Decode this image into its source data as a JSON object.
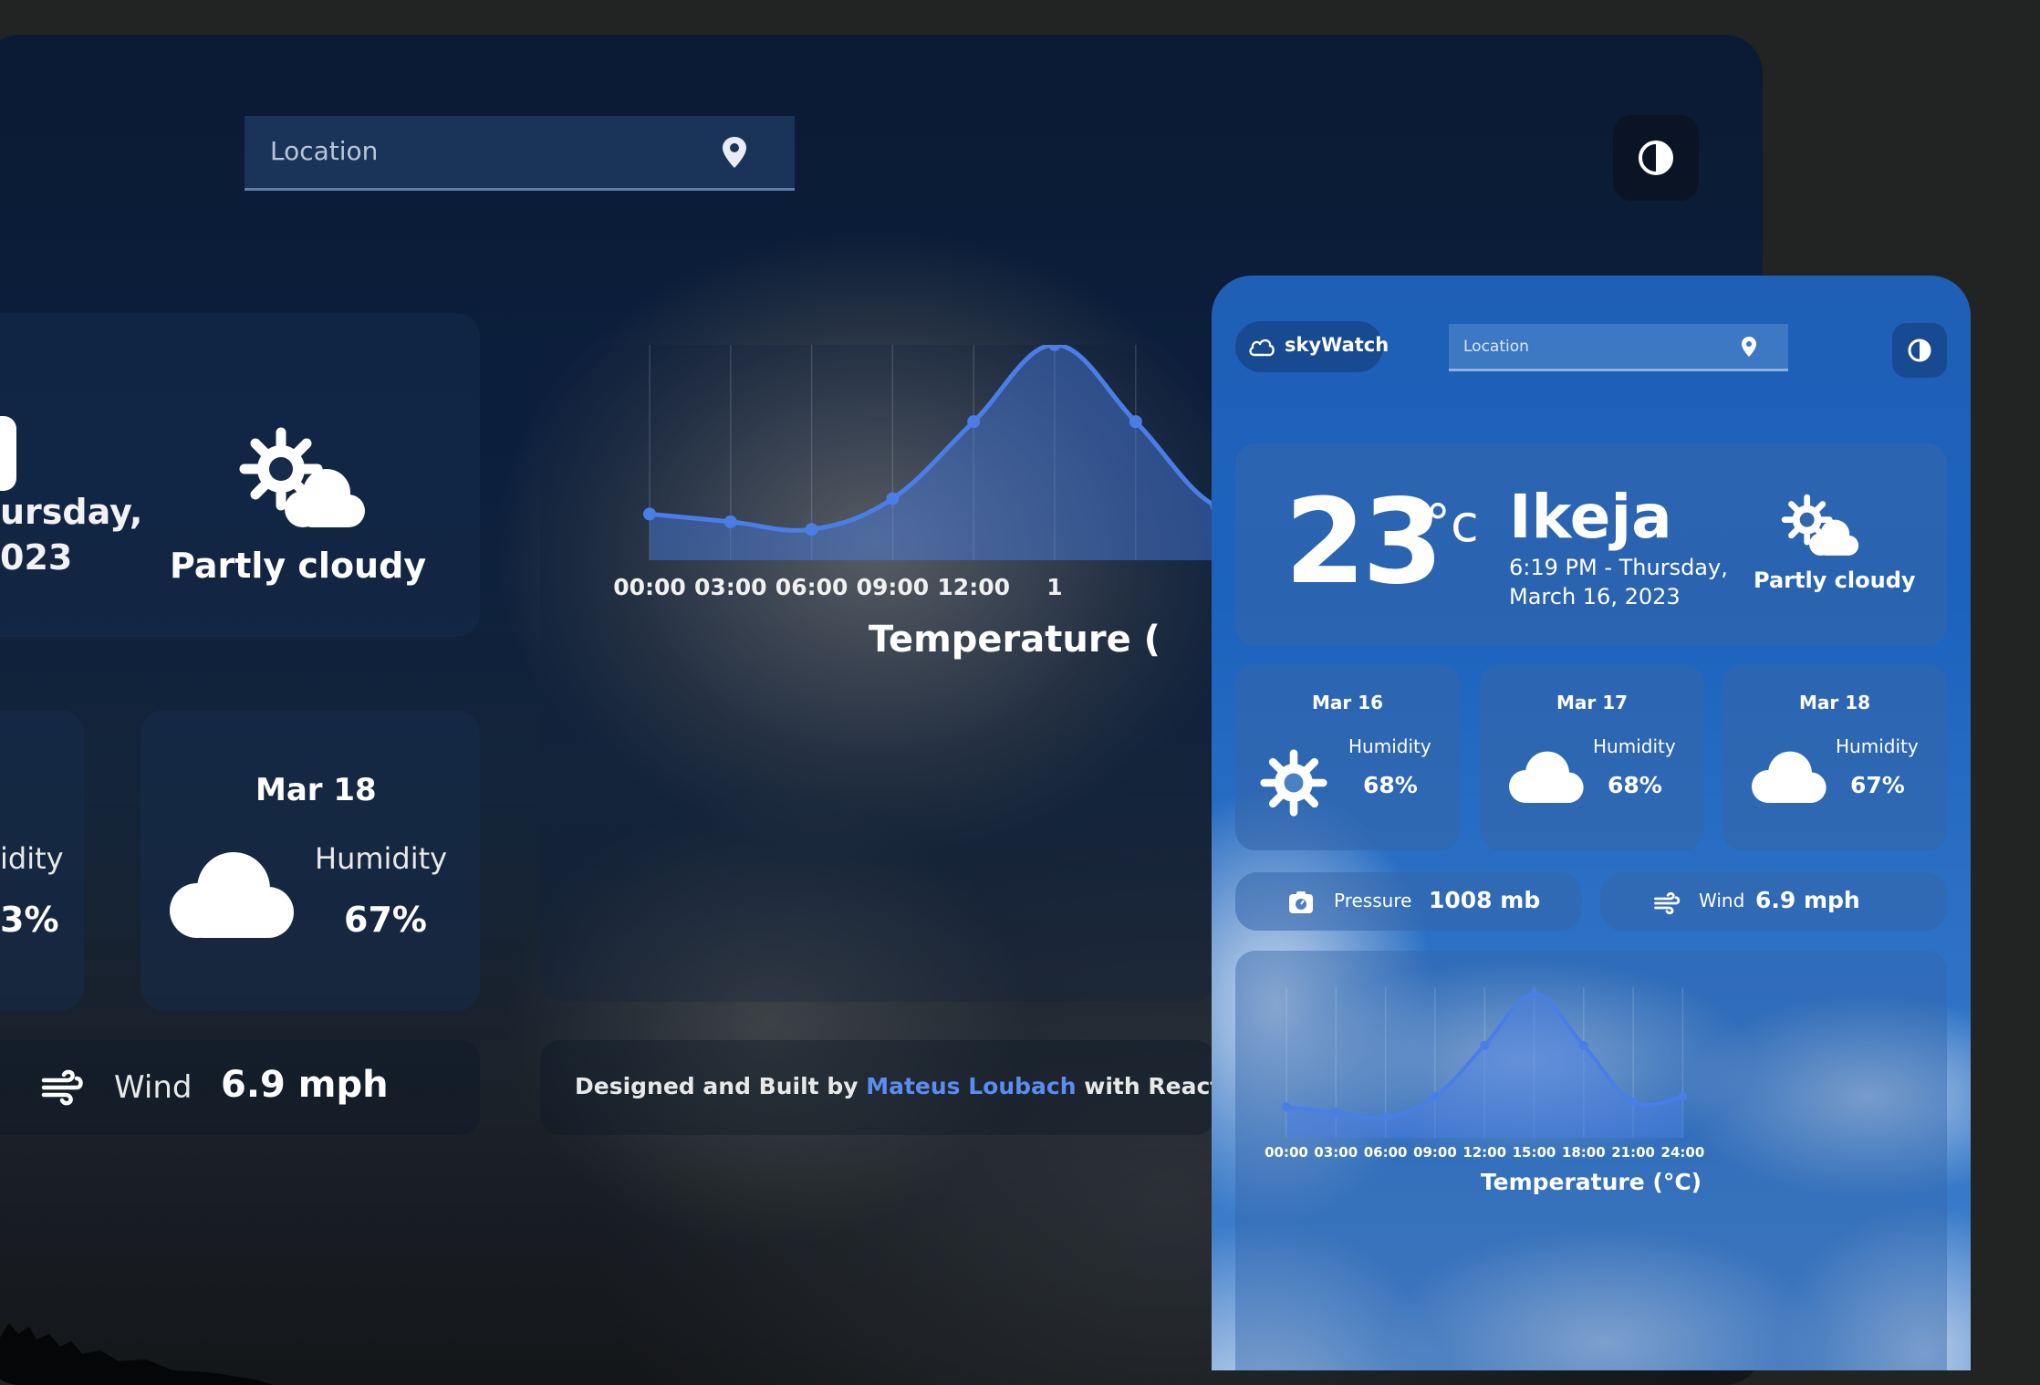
{
  "desktop": {
    "search": {
      "placeholder": "Location"
    },
    "current": {
      "date_line1": "ursday,",
      "date_line2": "023",
      "condition": "Partly cloudy"
    },
    "forecast_partial": {
      "humidity_label": "idity",
      "humidity_value": "3%"
    },
    "forecast": {
      "date": "Mar 18",
      "humidity_label": "Humidity",
      "humidity_value": "67%"
    },
    "wind": {
      "label": "Wind",
      "value": "6.9 mph"
    },
    "footer": {
      "prefix": "Designed and Built by ",
      "author": "Mateus Loubach",
      "suffix": " with React, CSS, Ch"
    },
    "chart": {
      "title": "Temperature (",
      "ticks": [
        "00:00",
        "03:00",
        "06:00",
        "09:00",
        "12:00",
        "1"
      ]
    }
  },
  "mobile": {
    "brand": "skyWatch",
    "search": {
      "placeholder": "Location"
    },
    "current": {
      "temp": "23",
      "unit": "°c",
      "city": "Ikeja",
      "datetime": "6:19 PM - Thursday, March 16, 2023",
      "condition": "Partly cloudy"
    },
    "days": [
      {
        "date": "Mar 16",
        "humidity_label": "Humidity",
        "humidity_value": "68%",
        "icon": "sun-icon"
      },
      {
        "date": "Mar 17",
        "humidity_label": "Humidity",
        "humidity_value": "68%",
        "icon": "cloud-icon"
      },
      {
        "date": "Mar 18",
        "humidity_label": "Humidity",
        "humidity_value": "67%",
        "icon": "cloud-icon"
      }
    ],
    "pressure": {
      "label": "Pressure",
      "value": "1008 mb"
    },
    "wind": {
      "label": "Wind",
      "value": "6.9 mph"
    },
    "chart_title": "Temperature (°C)"
  },
  "colors": {
    "accent": "#4a7ee6",
    "link": "#5b8cf0",
    "mobile_bg": "#1f5fb6",
    "desktop_bg": "#0b1f3d"
  },
  "chart_data": {
    "type": "area",
    "title": "Temperature (°C)",
    "x": [
      "00:00",
      "03:00",
      "06:00",
      "09:00",
      "12:00",
      "15:00",
      "18:00",
      "21:00",
      "24:00"
    ],
    "series": [
      {
        "values": [
          22,
          21.5,
          21,
          23,
          28,
          33,
          28,
          22.5,
          23
        ]
      }
    ],
    "ylim": [
      19,
      35
    ],
    "grid": true
  }
}
